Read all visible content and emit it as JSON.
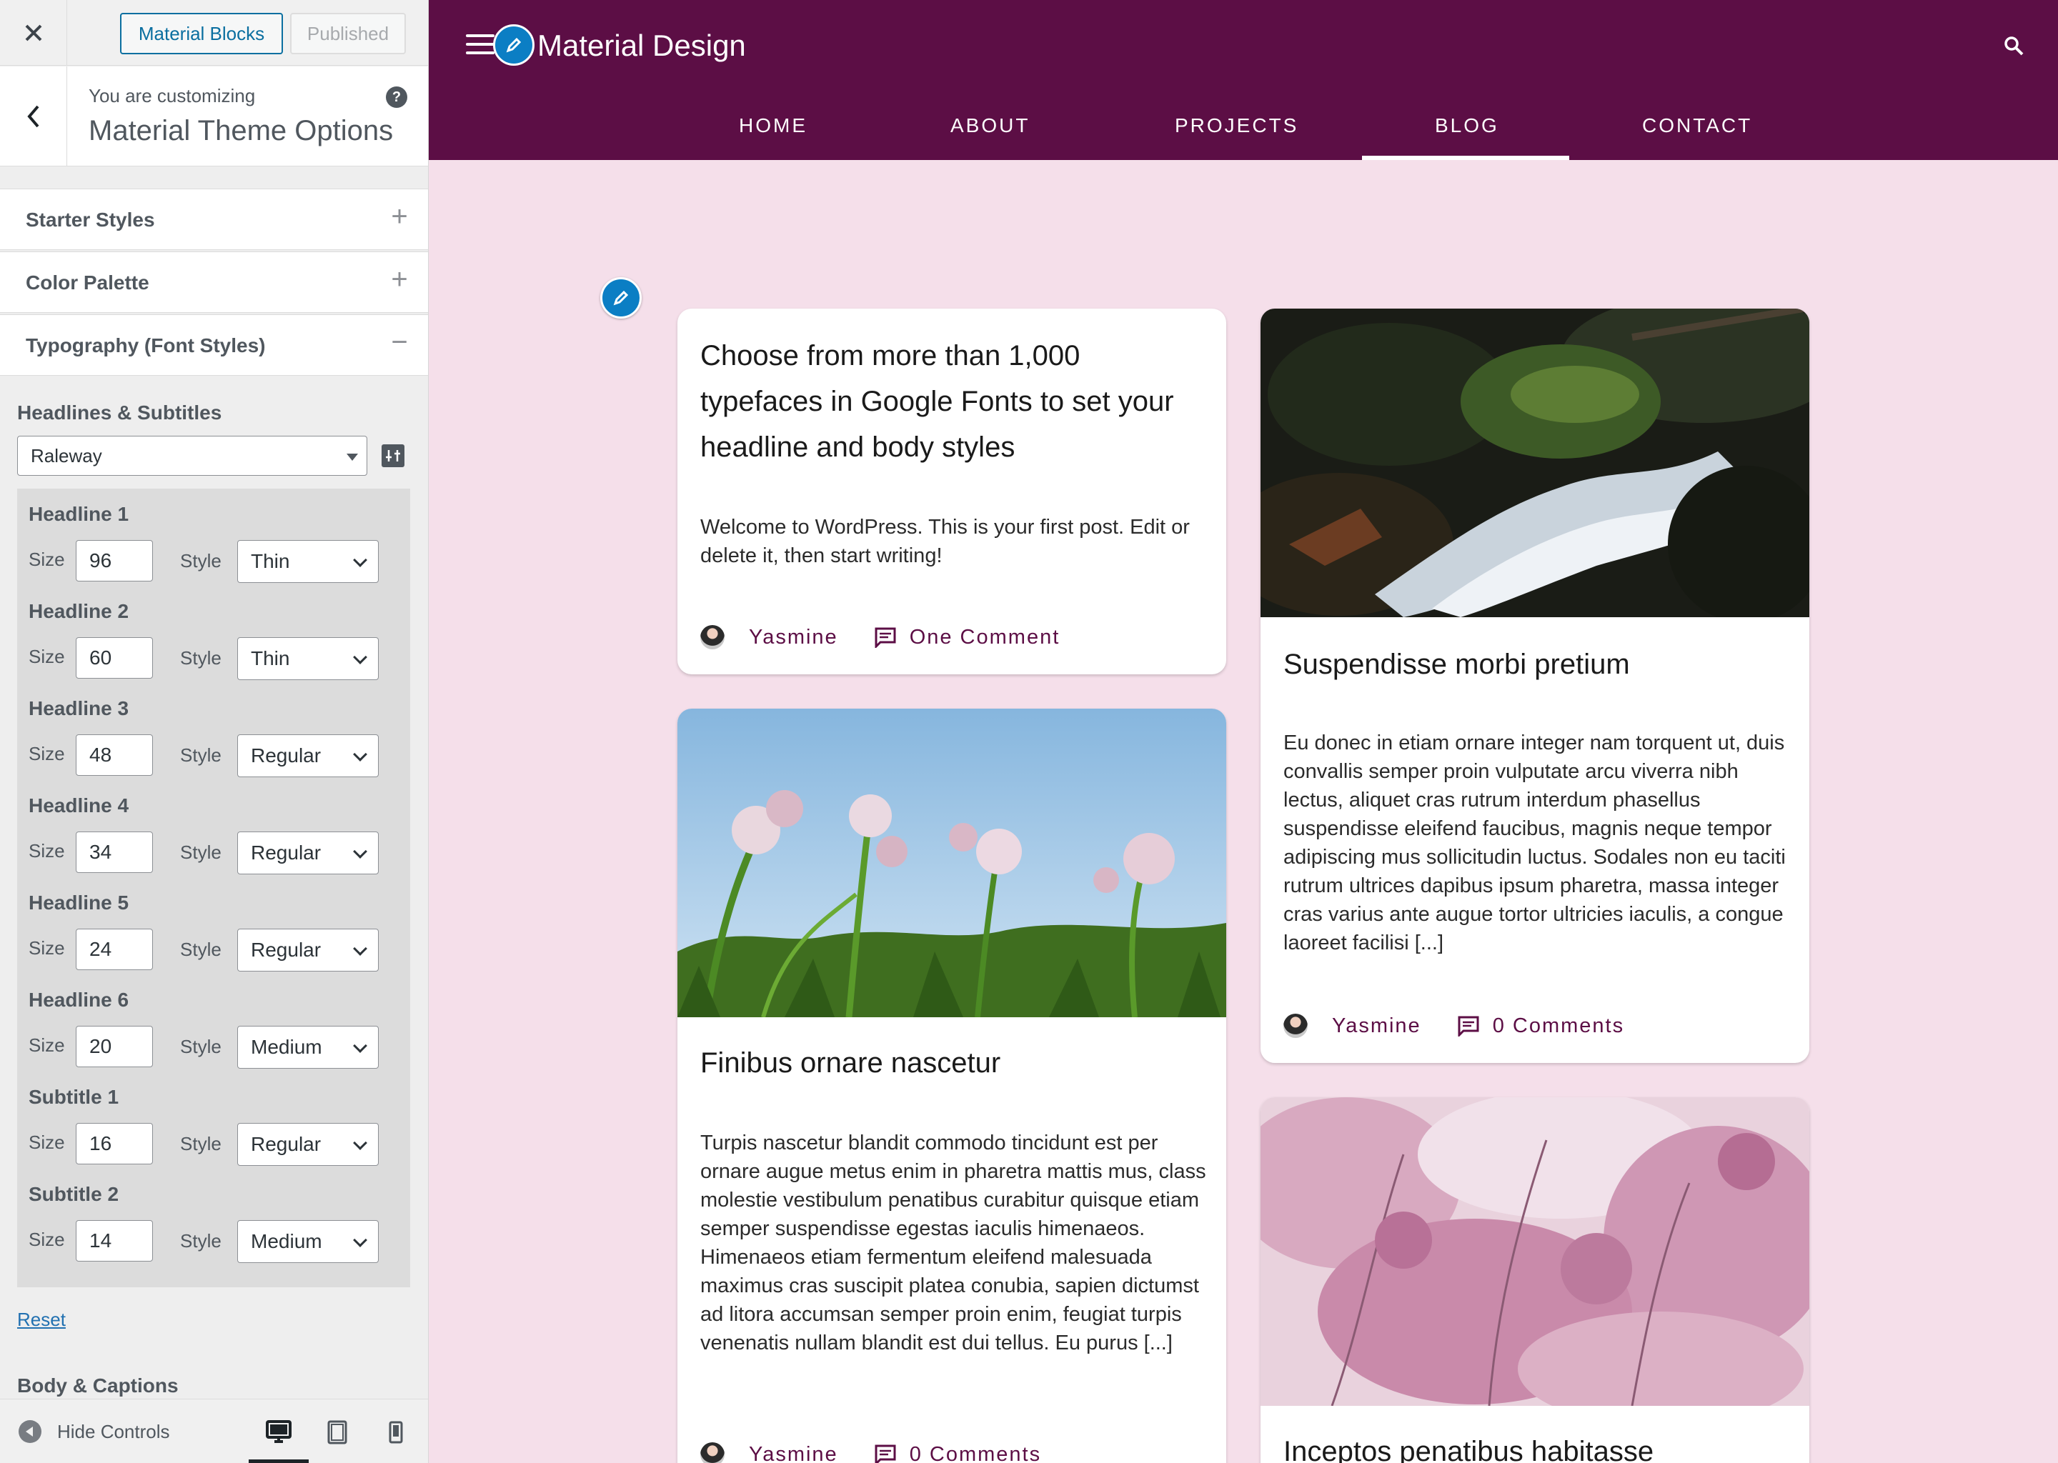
{
  "sidebar": {
    "top": {
      "publish_mode": "Material Blocks",
      "published": "Published"
    },
    "info": {
      "small": "You are customizing",
      "title": "Material Theme Options"
    },
    "sections": [
      {
        "label": "Starter Styles",
        "sign": "+"
      },
      {
        "label": "Color Palette",
        "sign": "+"
      },
      {
        "label": "Typography (Font Styles)",
        "sign": "−"
      }
    ],
    "headlines_label": "Headlines & Subtitles",
    "font_family": "Raleway",
    "size_label": "Size",
    "style_label": "Style",
    "headlines": [
      {
        "name": "Headline 1",
        "size": "96",
        "style": "Thin"
      },
      {
        "name": "Headline 2",
        "size": "60",
        "style": "Thin"
      },
      {
        "name": "Headline 3",
        "size": "48",
        "style": "Regular"
      },
      {
        "name": "Headline 4",
        "size": "34",
        "style": "Regular"
      },
      {
        "name": "Headline 5",
        "size": "24",
        "style": "Regular"
      },
      {
        "name": "Headline 6",
        "size": "20",
        "style": "Medium"
      },
      {
        "name": "Subtitle 1",
        "size": "16",
        "style": "Regular"
      },
      {
        "name": "Subtitle 2",
        "size": "14",
        "style": "Medium"
      }
    ],
    "reset": "Reset",
    "body_label": "Body & Captions",
    "footer": {
      "hide_controls": "Hide Controls",
      "devices": [
        "desktop-icon",
        "tablet-icon",
        "mobile-icon"
      ]
    }
  },
  "site": {
    "title": "Material Design",
    "nav": [
      "HOME",
      "ABOUT",
      "PROJECTS",
      "BLOG",
      "CONTACT"
    ],
    "active_nav": "BLOG",
    "colors": {
      "primary": "#5c0e45",
      "background": "#f5dfea",
      "edit": "#0b7ec4"
    }
  },
  "posts": [
    {
      "title": "Choose from more than 1,000 typefaces in Google Fonts to set your headline and body styles",
      "excerpt": "Welcome to WordPress. This is your first post. Edit or delete it, then start writing!",
      "author": "Yasmine",
      "comments": "One Comment"
    },
    {
      "title": "Suspendisse morbi pretium",
      "excerpt": "Eu donec in etiam ornare integer nam torquent ut, duis convallis semper proin vulputate arcu viverra nibh lectus, aliquet cras rutrum interdum phasellus suspendisse eleifend faucibus, magnis neque tempor adipiscing mus sollicitudin luctus. Sodales non eu taciti rutrum ultrices dapibus ipsum pharetra, massa integer cras varius ante augue tortor ultricies iaculis, a congue laoreet facilisi [...]",
      "author": "Yasmine",
      "comments": "0 Comments"
    },
    {
      "title": "Finibus ornare nascetur",
      "excerpt": "Turpis nascetur blandit commodo tincidunt est per ornare augue metus enim in pharetra mattis mus, class molestie vestibulum penatibus curabitur quisque etiam semper suspendisse egestas iaculis himenaeos. Himenaeos etiam fermentum eleifend malesuada maximus cras suscipit platea conubia, sapien dictumst ad litora accumsan semper proin enim, feugiat turpis venenatis nullam blandit est dui tellus. Eu purus [...]",
      "author": "Yasmine",
      "comments": "0 Comments"
    },
    {
      "title": "Inceptos penatibus habitasse"
    }
  ]
}
